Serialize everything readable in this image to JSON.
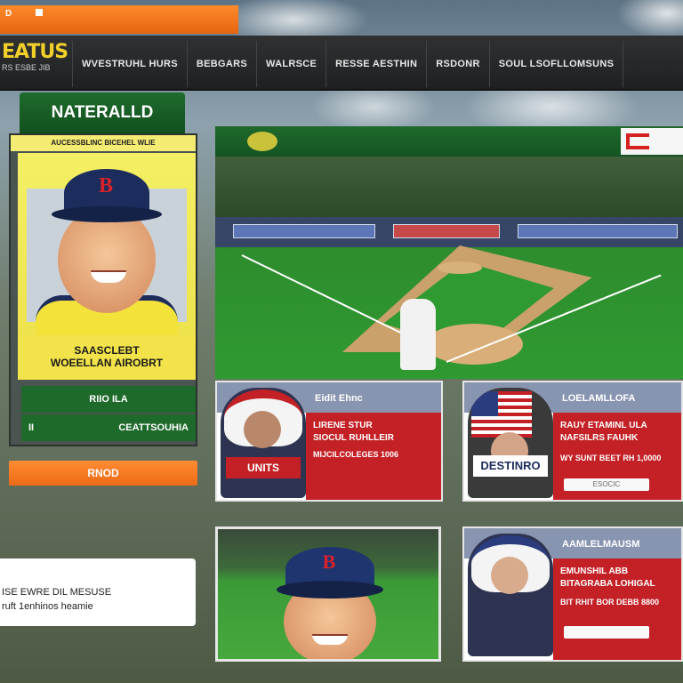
{
  "top_bar": {
    "text": "D"
  },
  "nav": {
    "logo_main": "EATUS",
    "logo_sub": "RS ESBE JIB",
    "items": [
      "WVESTRUHL HURS",
      "BEBGARS",
      "WALRSCE",
      "RESSE AESTHIN",
      "RSDONR",
      "SOUL LSOFLLOMSUNS"
    ]
  },
  "left": {
    "title": "NATERALLD",
    "card_header": "AUCESSBLINC BICEHEL WLIE",
    "caption_line1": "SAASCLEBT",
    "caption_line2": "WOEELLAN AIROBRT",
    "stat1": "RIIO ILA",
    "stat2_left": "II",
    "stat2_right": "CEATTSOUHIA",
    "orange_button": "RNOD",
    "note_line1": "ISE EWRE DIL MESUSE",
    "note_line2": "ruft 1enhinos heamie"
  },
  "cards": [
    {
      "header": "Eidit Ehnc",
      "plate": "UNITS",
      "line1": "LIRENE STUR",
      "line2": "SIOCUL RUHLLEIR",
      "line3": "MIJCILCOLEGES 1006",
      "button": ""
    },
    {
      "header": "LOELAMLLOFA",
      "plate": "DESTINRO",
      "line1": "RAUY ETAMINL ULA",
      "line2": "NAFSILRS FAUHK",
      "line3": "WY SUNT BEET RH 1,0000",
      "button": "ESOCIC"
    },
    {
      "header": "AAMLELMAUSM",
      "plate": "",
      "line1": "EMUNSHIL ABB",
      "line2": "BITAGRABA LOHIGAL",
      "line3": "BIT RHIT BOR DEBB 8800",
      "button": ""
    }
  ]
}
